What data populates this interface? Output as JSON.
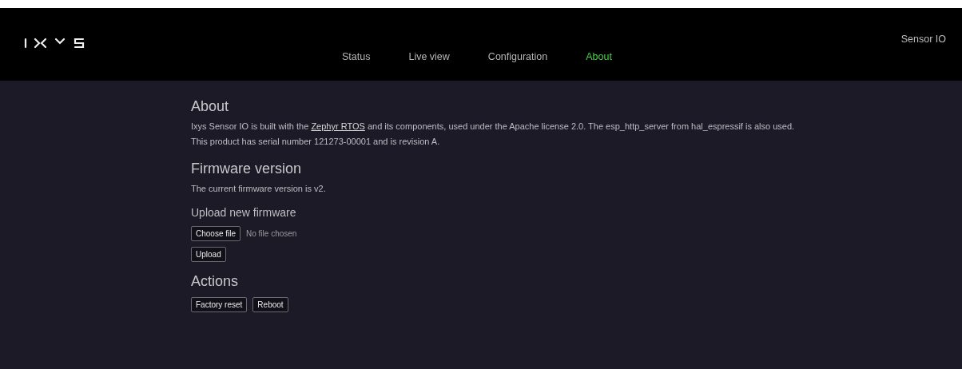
{
  "header": {
    "nav": [
      {
        "label": "Status",
        "selected": false
      },
      {
        "label": "Live view",
        "selected": false
      },
      {
        "label": "Configuration",
        "selected": false
      },
      {
        "label": "About",
        "selected": true
      }
    ],
    "device": "Sensor IO"
  },
  "about": {
    "title": "About",
    "intro_before": "Ixys Sensor IO is built with the ",
    "link": "Zephyr RTOS",
    "intro_after": " and its components, used under the Apache license 2.0. The esp_http_server from hal_espressif is also used.",
    "serial": "This product has serial number 121273-00001 and is revision A."
  },
  "firmware": {
    "title": "Firmware version",
    "text": "The current firmware version is v2.",
    "upload_title": "Upload new firmware",
    "choose_button": "Choose file",
    "file_status": "No file chosen",
    "upload_button": "Upload"
  },
  "actions": {
    "title": "Actions",
    "buttons": [
      "Factory reset",
      "Reboot"
    ]
  }
}
